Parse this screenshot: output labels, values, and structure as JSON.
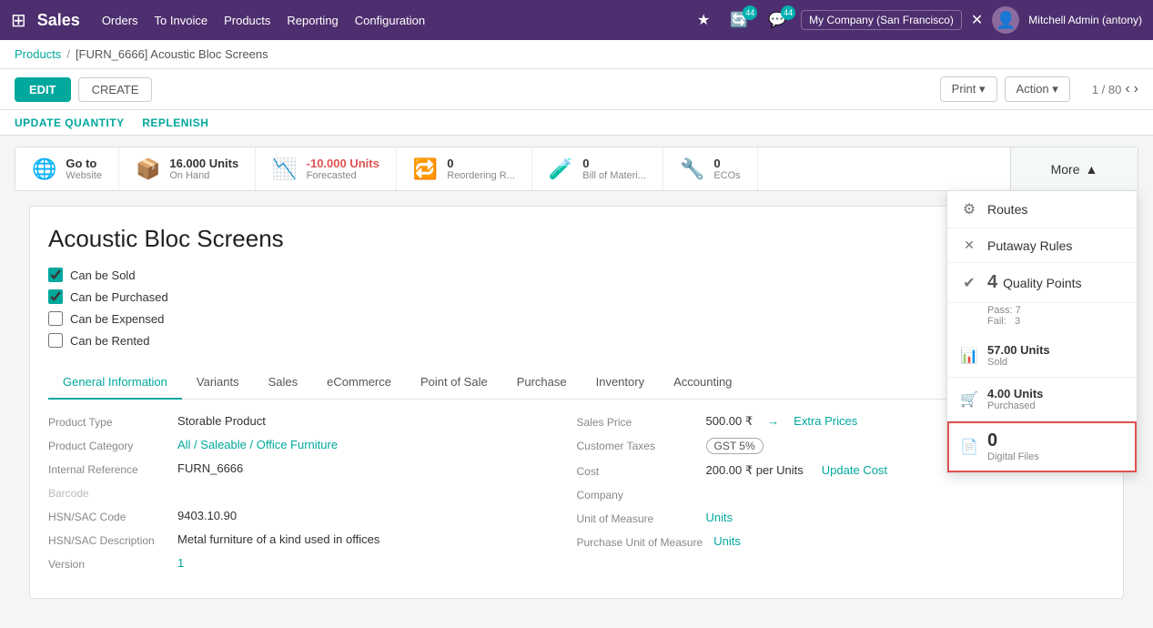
{
  "topnav": {
    "app_name": "Sales",
    "nav_links": [
      "Orders",
      "To Invoice",
      "Products",
      "Reporting",
      "Configuration"
    ],
    "badge_count_1": "44",
    "badge_count_2": "44",
    "company": "My Company (San Francisco)",
    "user": "Mitchell Admin (antony)"
  },
  "breadcrumb": {
    "parent": "Products",
    "current": "[FURN_6666] Acoustic Bloc Screens"
  },
  "action_bar": {
    "edit_label": "EDIT",
    "create_label": "CREATE",
    "print_label": "Print",
    "action_label": "Action",
    "counter": "1 / 80"
  },
  "smart_buttons": {
    "update_qty": "UPDATE QUANTITY",
    "replenish": "REPLENISH"
  },
  "stats": [
    {
      "icon": "🌐",
      "value": "Go to",
      "label": "Website"
    },
    {
      "icon": "📦",
      "value": "16.000 Units",
      "label": "On Hand"
    },
    {
      "icon": "📊",
      "value": "-10.000 Units",
      "label": "Forecasted",
      "negative": true
    },
    {
      "icon": "🔁",
      "value": "0",
      "label": "Reordering R..."
    },
    {
      "icon": "🧪",
      "value": "0",
      "label": "Bill of Materi..."
    },
    {
      "icon": "🔧",
      "value": "0",
      "label": "ECOs"
    }
  ],
  "more_button_label": "More",
  "more_dropdown": [
    {
      "icon": "⚙",
      "text": "Routes",
      "count": null
    },
    {
      "icon": "✕",
      "text": "Putaway Rules",
      "count": null,
      "cross": true
    },
    {
      "icon": "✔",
      "text": "Quality Points",
      "count": "4",
      "highlighted": false
    },
    {
      "pass": "Pass: 7",
      "fail": "Fail:   3"
    },
    {
      "icon": "📊",
      "text": "57.00 Units\nSold",
      "count": null,
      "bars": true
    },
    {
      "icon": "🛒",
      "text": "4.00 Units\nPurchased",
      "count": null
    },
    {
      "icon": "📄",
      "text": "0\nDigital Files",
      "count": null,
      "highlighted": true
    }
  ],
  "product": {
    "title": "Acoustic Bloc Screens",
    "checkboxes": [
      {
        "label": "Can be Sold",
        "checked": true
      },
      {
        "label": "Can be Purchased",
        "checked": true
      },
      {
        "label": "Can be Expensed",
        "checked": false
      },
      {
        "label": "Can be Rented",
        "checked": false
      }
    ]
  },
  "tabs": [
    {
      "label": "General Information",
      "active": true
    },
    {
      "label": "Variants",
      "active": false
    },
    {
      "label": "Sales",
      "active": false
    },
    {
      "label": "eCommerce",
      "active": false
    },
    {
      "label": "Point of Sale",
      "active": false
    },
    {
      "label": "Purchase",
      "active": false
    },
    {
      "label": "Inventory",
      "active": false
    },
    {
      "label": "Accounting",
      "active": false
    }
  ],
  "form_left": [
    {
      "label": "Product Type",
      "value": "Storable Product",
      "link": false
    },
    {
      "label": "Product Category",
      "value": "All / Saleable / Office Furniture",
      "link": true
    },
    {
      "label": "Internal Reference",
      "value": "FURN_6666",
      "link": false
    },
    {
      "label": "Barcode",
      "value": "",
      "link": false
    },
    {
      "label": "HSN/SAC Code",
      "value": "9403.10.90",
      "link": false
    },
    {
      "label": "HSN/SAC Description",
      "value": "Metal furniture of a kind used in offices",
      "link": false
    },
    {
      "label": "Version",
      "value": "1",
      "link": true
    }
  ],
  "form_right": [
    {
      "label": "Sales Price",
      "value": "500.00 ₹",
      "extra": "Extra Prices",
      "link": false
    },
    {
      "label": "Customer Taxes",
      "value": "GST 5%",
      "badge": true
    },
    {
      "label": "Cost",
      "value": "200.00 ₹ per Units",
      "update": "Update Cost"
    },
    {
      "label": "Company",
      "value": ""
    },
    {
      "label": "Unit of Measure",
      "value": "Units",
      "link": true
    },
    {
      "label": "Purchase Unit of\nMeasure",
      "value": "Units",
      "link": true
    }
  ]
}
